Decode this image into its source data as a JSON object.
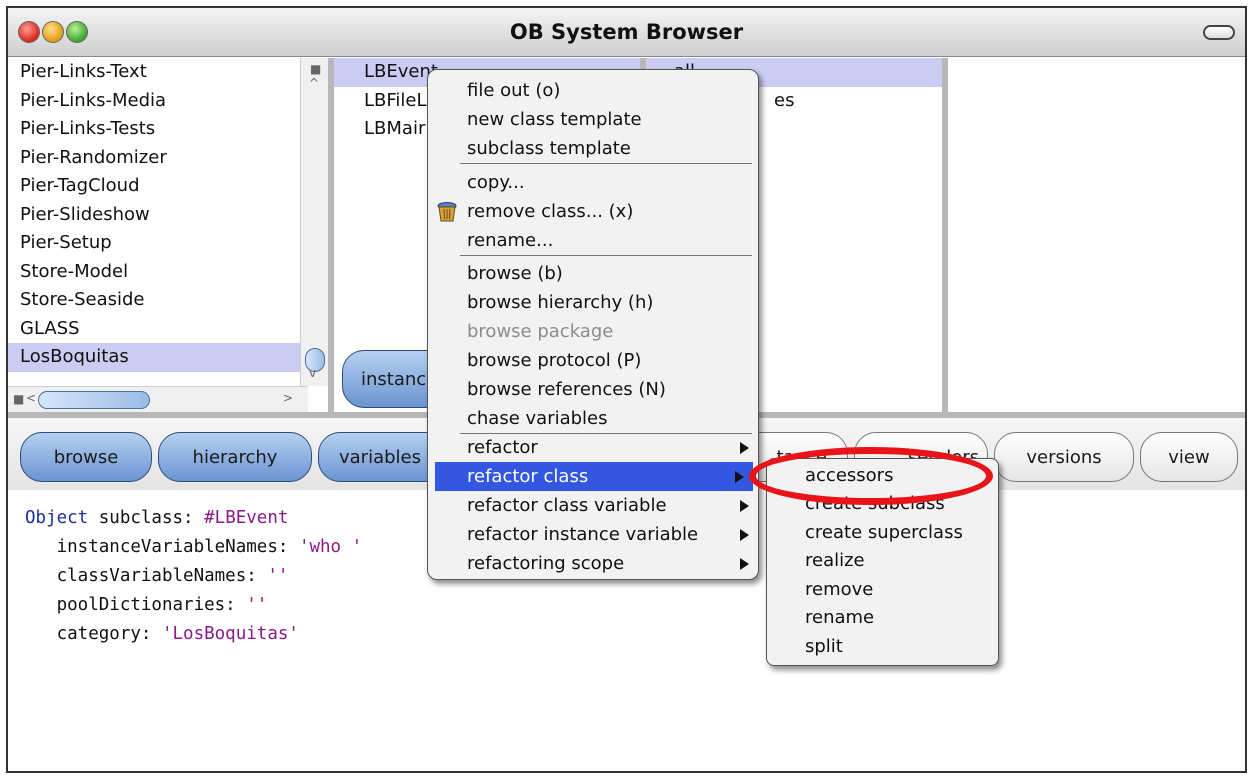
{
  "window": {
    "title": "OB System Browser"
  },
  "packages": [
    "Pier-Links-Text",
    "Pier-Links-Media",
    "Pier-Links-Tests",
    "Pier-Randomizer",
    "Pier-TagCloud",
    "Pier-Slideshow",
    "Pier-Setup",
    "Store-Model",
    "Store-Seaside",
    "GLASS",
    "LosBoquitas"
  ],
  "packages_selected": "LosBoquitas",
  "classes": [
    "LBEvent",
    "LBFileL",
    "LBMair"
  ],
  "protocols": [
    "all",
    "es"
  ],
  "instance_button": "instanc",
  "buttons": [
    "browse",
    "hierarchy",
    "variables",
    "tance",
    "senders",
    "versions",
    "view"
  ],
  "code": {
    "line1_class": "Object",
    "line1_msg": " subclass: ",
    "line1_sym": "#LBEvent",
    "line2_key": "instanceVariableNames: ",
    "line2_val": "'who '",
    "line3_key": "classVariableNames: ",
    "line3_val": "''",
    "line4_key": "poolDictionaries: ",
    "line4_val": "''",
    "line5_key": "category: ",
    "line5_val": "'LosBoquitas'"
  },
  "menu": {
    "items": [
      "file out (o)",
      "new class template",
      "subclass template",
      "copy...",
      "remove class... (x)",
      "rename...",
      "browse (b)",
      "browse hierarchy (h)",
      "browse package",
      "browse protocol (P)",
      "browse references (N)",
      "chase variables",
      "refactor",
      "refactor class",
      "refactor class variable",
      "refactor instance variable",
      "refactoring scope"
    ],
    "disabled": "browse package",
    "highlighted": "refactor class"
  },
  "submenu": {
    "items": [
      "accessors",
      "create subclass",
      "create superclass",
      "realize",
      "remove",
      "rename",
      "split"
    ]
  },
  "colors": {
    "highlight": "#3357e0",
    "selection": "#ccccf2",
    "annotation": "#e8141a"
  }
}
